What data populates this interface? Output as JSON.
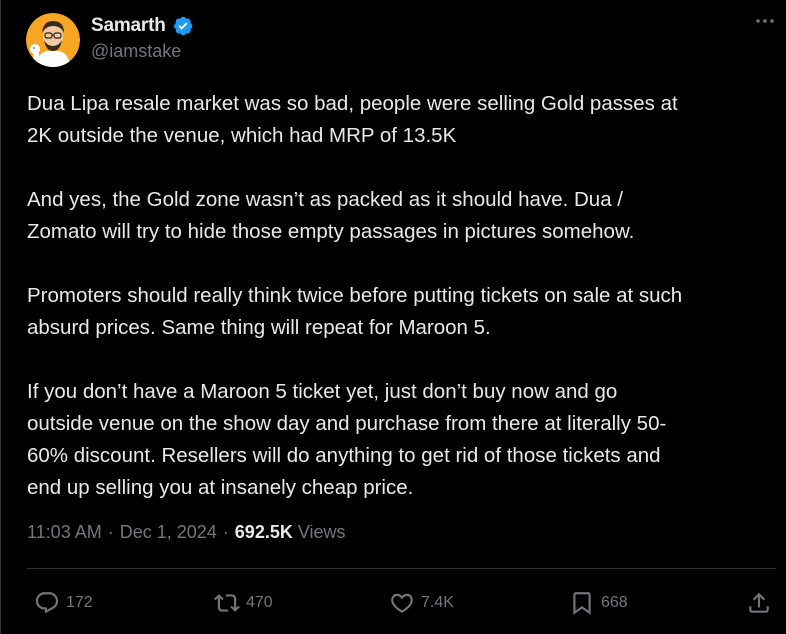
{
  "author": {
    "display_name": "Samarth",
    "handle": "@iamstake",
    "verified": true
  },
  "more_icon": "more-horizontal-icon",
  "tweet": {
    "paragraphs": [
      "Dua Lipa resale market was so bad, people were selling Gold passes at\n2K outside the venue, which had MRP of 13.5K",
      "And yes, the Gold zone wasn’t as packed as it should have. Dua /\nZomato will try to hide those empty passages in pictures somehow.",
      "Promoters should really think twice before putting tickets on sale at such\nabsurd prices. Same thing will repeat for Maroon 5.",
      "If you don’t have a Maroon 5 ticket yet, just don’t buy now and go\noutside venue on the show day and purchase from there at literally 50-\n60% discount. Resellers will do anything to get rid of those tickets and\nend up selling you at insanely cheap price."
    ]
  },
  "meta": {
    "time": "11:03 AM",
    "separator": "·",
    "date": "Dec 1, 2024",
    "views_count": "692.5K",
    "views_label": "Views"
  },
  "actions": {
    "replies": "172",
    "reposts": "470",
    "likes": "7.4K",
    "bookmarks": "668"
  },
  "colors": {
    "background": "#000000",
    "text": "#e7e9ea",
    "secondary_text": "#71767b",
    "divider": "#2f3336",
    "verified_badge": "#1d9bf0"
  }
}
